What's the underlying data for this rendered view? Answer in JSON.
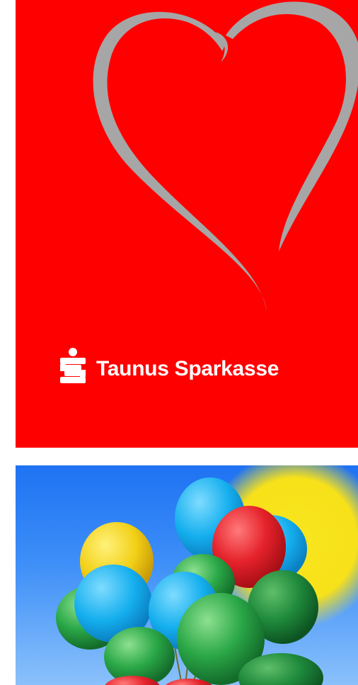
{
  "banner": {
    "brand_name": "Taunus Sparkasse",
    "background_color": "#ff0000",
    "heart_color": "#a6a6a6",
    "logo_icon": "sparkasse-s-logo-icon"
  },
  "photo": {
    "subject_icon": "balloons-image",
    "sky_color": "#2b7df5",
    "sun_color": "#f7e11a",
    "balloon_colors": [
      "#18b3ee",
      "#f0d21c",
      "#e8222a",
      "#2aa846",
      "#1f8a3c"
    ]
  }
}
